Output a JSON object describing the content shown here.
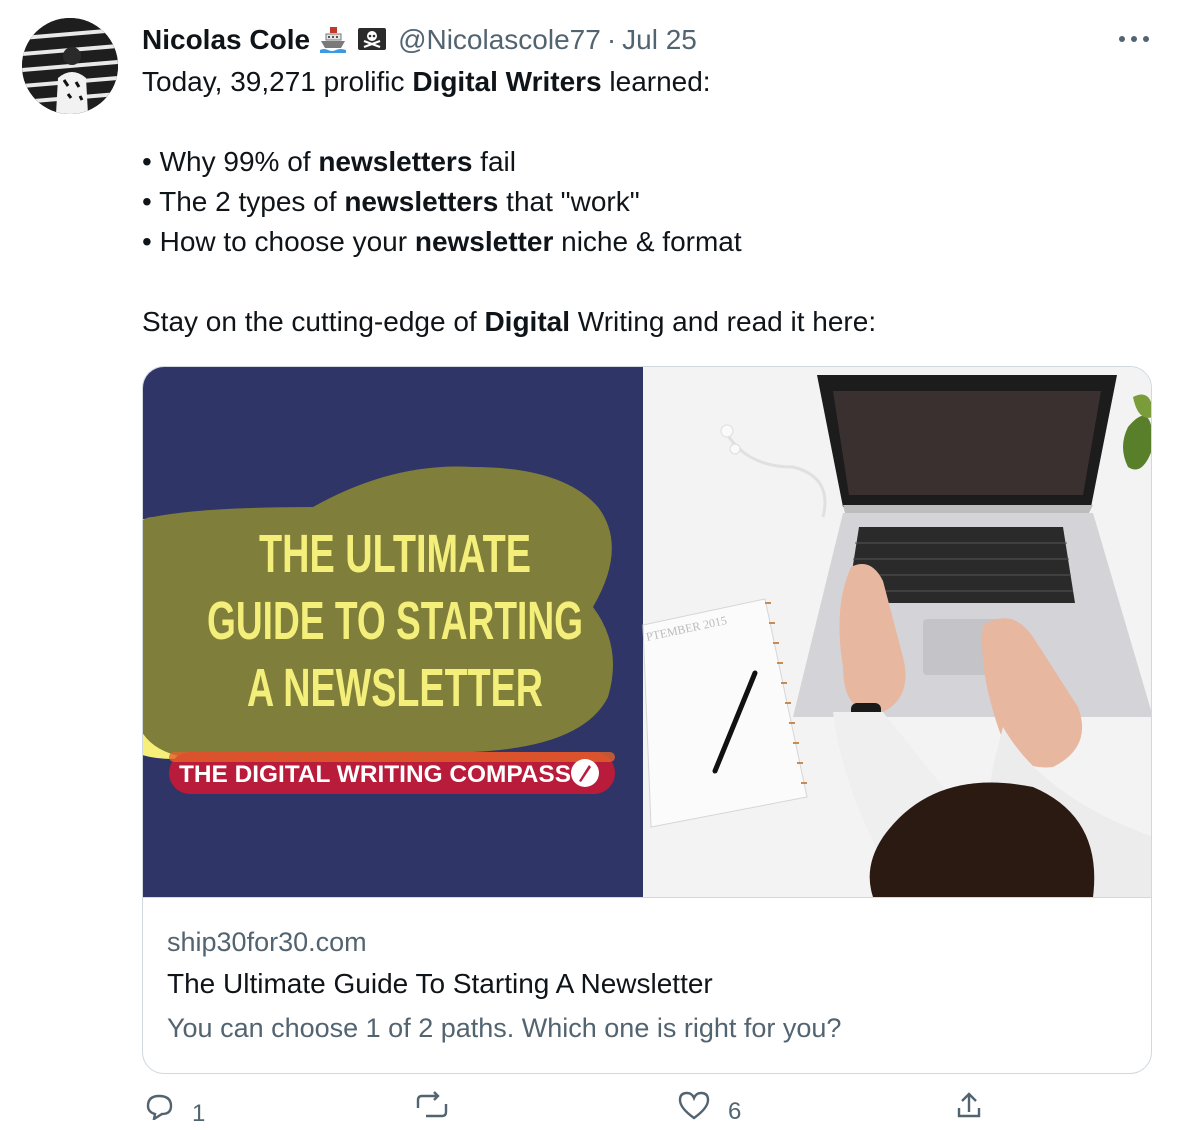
{
  "tweet": {
    "author_name": "Nicolas Cole",
    "author_emojis": [
      "ship-icon",
      "pirate-flag-icon"
    ],
    "handle": "@Nicolascole77",
    "separator": "·",
    "date": "Jul 25",
    "more_icon": "more-horizontal-icon",
    "text": {
      "line1_pre": "Today, 39,271 prolific ",
      "line1_bold": "Digital Writers",
      "line1_post": " learned:",
      "bullet_char": "•",
      "bullets": [
        {
          "pre": "Why 99% of ",
          "bold": "newsletters",
          "post": " fail"
        },
        {
          "pre": "The 2 types of ",
          "bold": "newsletters",
          "post": " that \"work\""
        },
        {
          "pre": "How to choose your ",
          "bold": "newsletter",
          "post": " niche & format"
        }
      ],
      "closing_pre": "Stay on the cutting-edge of ",
      "closing_bold": "Digital",
      "closing_post": " Writing and read it here:"
    }
  },
  "card": {
    "image": {
      "headline_lines": [
        "THE ULTIMATE",
        "GUIDE TO STARTING",
        "A NEWSLETTER"
      ],
      "banner_text": "THE DIGITAL WRITING COMPASS",
      "calendar_text": "PTEMBER 2015",
      "colors": {
        "left_panel": "#2f3566",
        "blob_olive": "#7f7e3a",
        "blob_yellow": "#f6f07a",
        "headline": "#f3ef7a",
        "banner": "#b81c3a"
      }
    },
    "domain": "ship30for30.com",
    "title": "The Ultimate Guide To Starting A Newsletter",
    "description": "You can choose 1 of 2 paths. Which one is right for you?"
  },
  "actions": {
    "reply_count": "1",
    "retweet_count": "",
    "like_count": "6"
  }
}
